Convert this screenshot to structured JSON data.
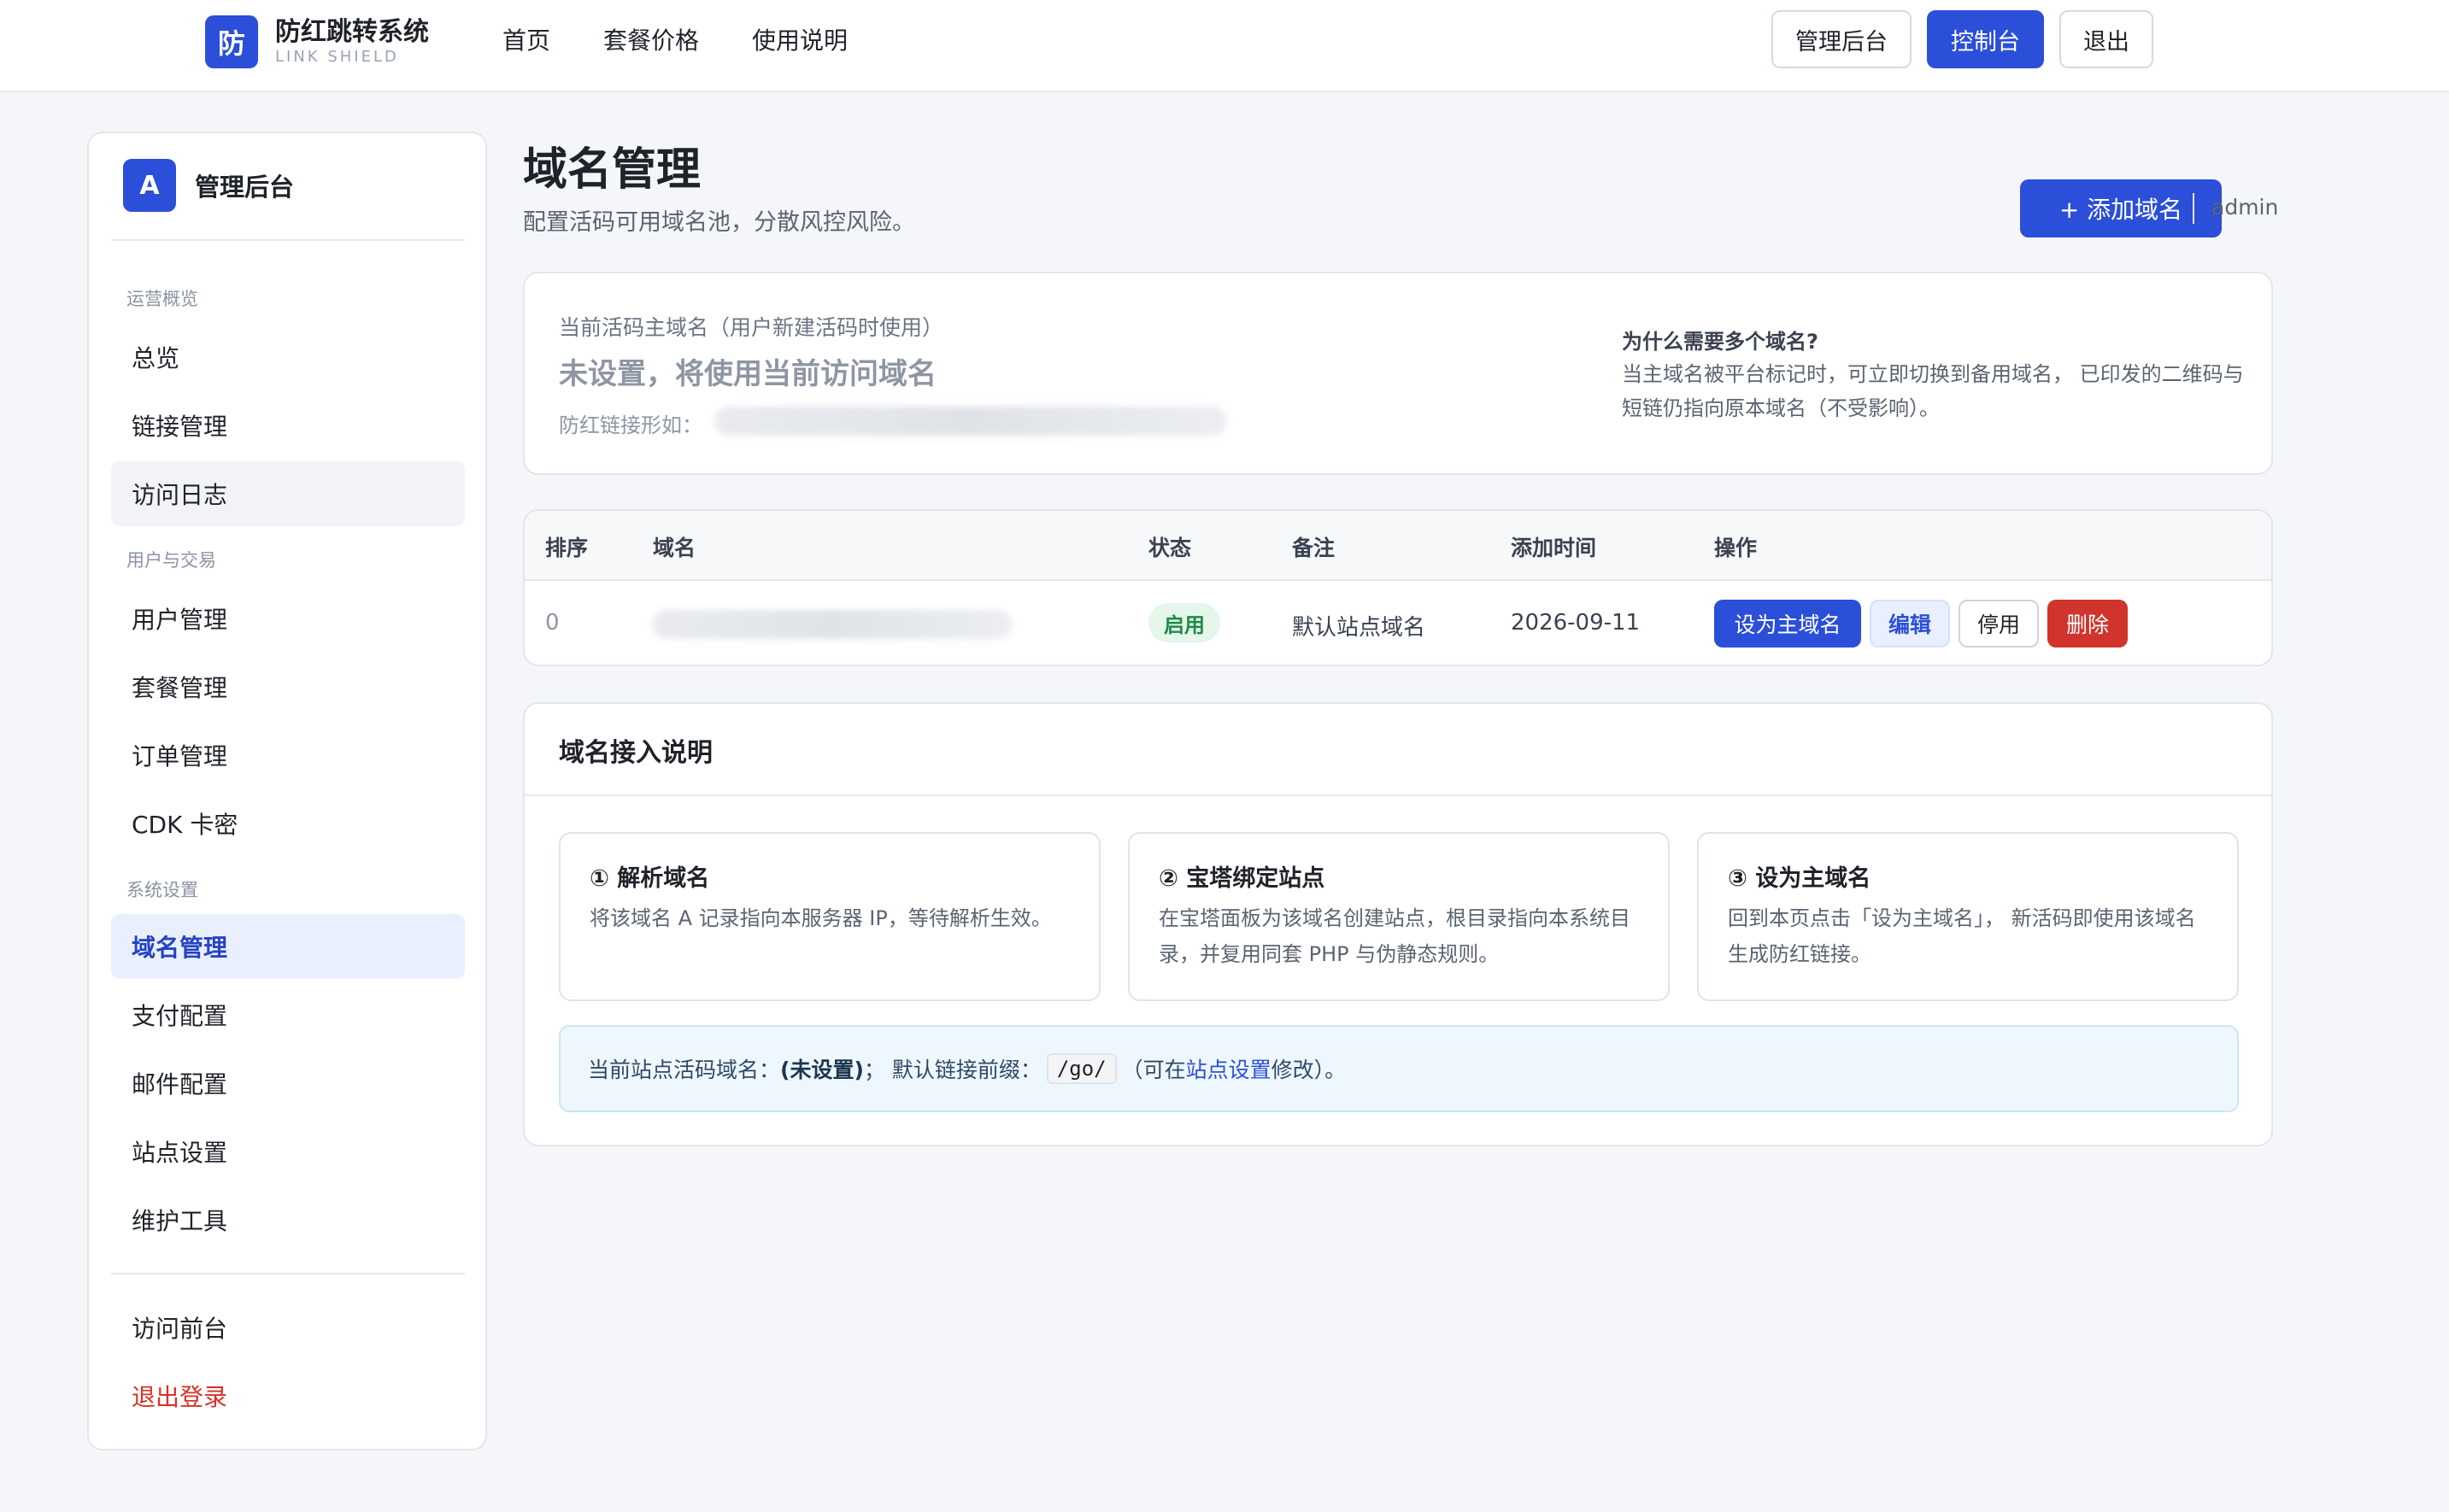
{
  "brand": {
    "logo_char": "防",
    "title": "防红跳转系统",
    "subtitle": "LINK SHIELD"
  },
  "nav": {
    "home": "首页",
    "pricing": "套餐价格",
    "docs": "使用说明"
  },
  "top_actions": {
    "admin": "管理后台",
    "console": "控制台",
    "logout": "退出"
  },
  "sidebar": {
    "avatar": "A",
    "title": "管理后台",
    "groups": {
      "ops": "运营概览",
      "users": "用户与交易",
      "system": "系统设置"
    },
    "items": {
      "overview": "总览",
      "links": "链接管理",
      "logs": "访问日志",
      "users": "用户管理",
      "plans": "套餐管理",
      "orders": "订单管理",
      "cdk": "CDK 卡密",
      "domains": "域名管理",
      "payment": "支付配置",
      "mail": "邮件配置",
      "site": "站点设置",
      "maintenance": "维护工具",
      "frontend": "访问前台",
      "signout": "退出登录"
    }
  },
  "page": {
    "title": "域名管理",
    "subtitle": "配置活码可用域名池，分散风控风险。",
    "add_button": "+ 添加域名",
    "user": "admin"
  },
  "main_domain": {
    "label": "当前活码主域名（用户新建活码时使用）",
    "value": "未设置，将使用当前访问域名",
    "link_label": "防红链接形如："
  },
  "why": {
    "title": "为什么需要多个域名?",
    "text": "当主域名被平台标记时，可立即切换到备用域名， 已印发的二维码与短链仍指向原本域名（不受影响）。"
  },
  "table": {
    "headers": {
      "order": "排序",
      "domain": "域名",
      "status": "状态",
      "note": "备注",
      "added": "添加时间",
      "actions": "操作"
    },
    "rows": [
      {
        "order": "0",
        "status": "启用",
        "note": "默认站点域名",
        "added": "2026-09-11"
      }
    ],
    "actions": {
      "set_main": "设为主域名",
      "edit": "编辑",
      "disable": "停用",
      "delete": "删除"
    }
  },
  "guide": {
    "title": "域名接入说明",
    "steps": [
      {
        "title": "① 解析域名",
        "text": "将该域名 A 记录指向本服务器 IP，等待解析生效。"
      },
      {
        "title": "② 宝塔绑定站点",
        "text": "在宝塔面板为该域名创建站点，根目录指向本系统目录，并复用同套 PHP 与伪静态规则。"
      },
      {
        "title": "③ 设为主域名",
        "text": "回到本页点击「设为主域名」， 新活码即使用该域名生成防红链接。"
      }
    ],
    "note": {
      "prefix": "当前站点活码域名：",
      "value": "(未设置)",
      "mid": "； 默认链接前缀：",
      "code": "/go/",
      "open": "（可在",
      "link": "站点设置",
      "close": "修改）。"
    }
  },
  "colors": {
    "primary": "#2b4fd8",
    "danger": "#d0342c",
    "success": "#1e8a44"
  }
}
